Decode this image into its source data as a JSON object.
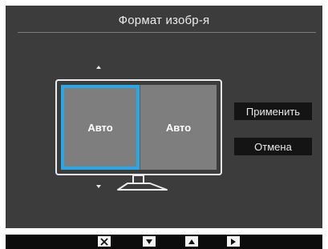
{
  "osd": {
    "title": "Формат изобр-я",
    "preview": {
      "left_label": "Авто",
      "right_label": "Авто",
      "selected": "left"
    },
    "buttons": {
      "apply_label": "Применить",
      "cancel_label": "Отмена"
    }
  },
  "nav": {
    "keys": [
      "close-icon",
      "arrow-down-icon",
      "arrow-up-icon",
      "play-icon"
    ]
  },
  "colors": {
    "panel": "#3c3c3c",
    "highlight": "#2aa7e8",
    "screen": "#7e7e7e",
    "button": "#141414",
    "navbar": "#0c0c0c"
  }
}
